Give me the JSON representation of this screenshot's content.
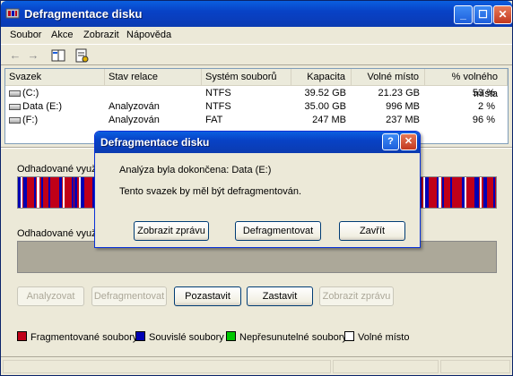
{
  "window": {
    "title": "Defragmentace disku",
    "min_icon": "_",
    "max_icon": "☐",
    "close_icon": "✕"
  },
  "menu": {
    "items": [
      "Soubor",
      "Akce",
      "Zobrazit",
      "Nápověda"
    ]
  },
  "toolbar": {
    "back_icon": "arrow-left-icon",
    "forward_icon": "arrow-right-icon",
    "view_icon": "view-icon",
    "properties_icon": "properties-icon"
  },
  "volumes": {
    "headers": [
      "Svazek",
      "Stav relace",
      "Systém souborů",
      "Kapacita",
      "Volné místo",
      "% volného místa"
    ],
    "rows": [
      {
        "volume": "(C:)",
        "status": "",
        "fs": "NTFS",
        "capacity": "39.52 GB",
        "free": "21.23 GB",
        "pct": "53 %"
      },
      {
        "volume": "Data (E:)",
        "status": "Analyzován",
        "fs": "NTFS",
        "capacity": "35.00 GB",
        "free": "996 MB",
        "pct": "2 %"
      },
      {
        "volume": "(F:)",
        "status": "Analyzován",
        "fs": "FAT",
        "capacity": "247 MB",
        "free": "237 MB",
        "pct": "96 %"
      }
    ]
  },
  "usage": {
    "before_label": "Odhadované využití",
    "after_label": "Odhadované využití",
    "colors": {
      "fragmented": "#c00018",
      "contiguous": "#0000b4",
      "unmovable": "#00c800",
      "free": "#ffffff"
    }
  },
  "buttons": {
    "analyze": "Analyzovat",
    "defrag": "Defragmentovat",
    "pause": "Pozastavit",
    "stop": "Zastavit",
    "report": "Zobrazit zprávu"
  },
  "legend": {
    "fragmented": "Fragmentované soubory",
    "contiguous": "Souvislé soubory",
    "unmovable": "Nepřesunutelné soubory",
    "free": "Volné místo"
  },
  "dialog": {
    "title": "Defragmentace disku",
    "help_icon": "?",
    "close_icon": "✕",
    "line1": "Analýza byla dokončena: Data (E:)",
    "line2": "Tento svazek by měl být defragmentován.",
    "btn_report": "Zobrazit zprávu",
    "btn_defrag": "Defragmentovat",
    "btn_close": "Zavřít"
  }
}
